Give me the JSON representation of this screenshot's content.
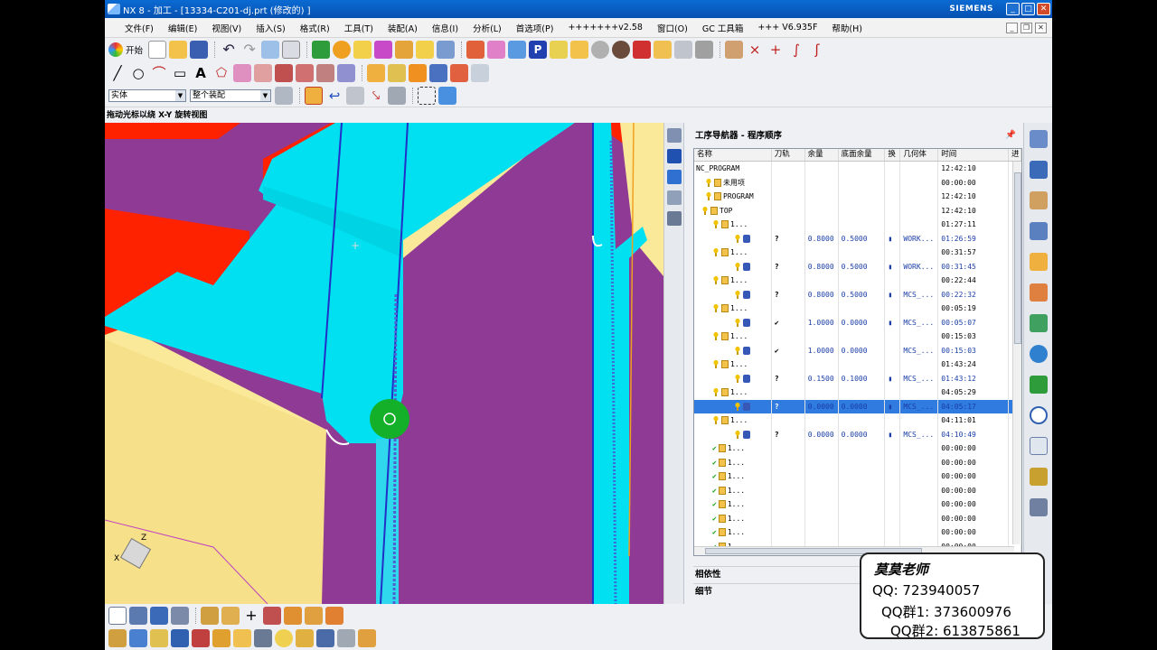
{
  "window": {
    "title": "NX 8 - 加工 - [13334-C201-dj.prt (修改的) ]",
    "brand": "SIEMENS",
    "controls": [
      "_",
      "□",
      "✕"
    ]
  },
  "menu": [
    "文件(F)",
    "编辑(E)",
    "视图(V)",
    "插入(S)",
    "格式(R)",
    "工具(T)",
    "装配(A)",
    "信息(I)",
    "分析(L)",
    "首选项(P)",
    "+++++++v2.58",
    "窗口(O)",
    "GC 工具箱",
    "+++ V6.935F",
    "帮助(H)"
  ],
  "toolbar": {
    "start_label": "开始",
    "filter_select": "实体",
    "assembly_select": "整个装配"
  },
  "cue_line": "拖动光标以绕 X-Y 旋转视图",
  "navigator": {
    "title": "工序导航器 - 程序顺序",
    "columns": [
      "名称",
      "刀轨",
      "余量",
      "底面余量",
      "换",
      "几何体",
      "时间",
      "进"
    ],
    "rows": [
      {
        "name": "NC_PROGRAM",
        "indent": 0,
        "icon": "none",
        "path": "",
        "stock": "",
        "floor": "",
        "chg": "",
        "geo": "",
        "time": "12:42:10",
        "selected": false
      },
      {
        "name": "未用项",
        "indent": 1,
        "icon": "folder",
        "path": "",
        "stock": "",
        "floor": "",
        "chg": "",
        "geo": "",
        "time": "00:00:00",
        "selected": false
      },
      {
        "name": "PROGRAM",
        "indent": 1,
        "icon": "folder",
        "path": "",
        "stock": "",
        "floor": "",
        "chg": "",
        "geo": "",
        "time": "12:42:10",
        "selected": false
      },
      {
        "name": "TOP",
        "indent": 2,
        "icon": "folder",
        "path": "",
        "stock": "",
        "floor": "",
        "chg": "",
        "geo": "",
        "time": "12:42:10",
        "selected": false
      },
      {
        "name": "1...",
        "indent": 3,
        "icon": "folder",
        "path": "",
        "stock": "",
        "floor": "",
        "chg": "",
        "geo": "",
        "time": "01:27:11",
        "selected": false
      },
      {
        "name": "",
        "indent": 4,
        "icon": "op",
        "path": "?",
        "stock": "0.8000",
        "floor": "0.5000",
        "chg": "▮",
        "geo": "WORK...",
        "time": "01:26:59",
        "selected": false
      },
      {
        "name": "1...",
        "indent": 3,
        "icon": "folder",
        "path": "",
        "stock": "",
        "floor": "",
        "chg": "",
        "geo": "",
        "time": "00:31:57",
        "selected": false
      },
      {
        "name": "",
        "indent": 4,
        "icon": "op",
        "path": "?",
        "stock": "0.8000",
        "floor": "0.5000",
        "chg": "▮",
        "geo": "WORK...",
        "time": "00:31:45",
        "selected": false
      },
      {
        "name": "1...",
        "indent": 3,
        "icon": "folder",
        "path": "",
        "stock": "",
        "floor": "",
        "chg": "",
        "geo": "",
        "time": "00:22:44",
        "selected": false
      },
      {
        "name": "",
        "indent": 4,
        "icon": "op",
        "path": "?",
        "stock": "0.8000",
        "floor": "0.5000",
        "chg": "▮",
        "geo": "MCS_...",
        "time": "00:22:32",
        "selected": false
      },
      {
        "name": "1...",
        "indent": 3,
        "icon": "folder",
        "path": "",
        "stock": "",
        "floor": "",
        "chg": "",
        "geo": "",
        "time": "00:05:19",
        "selected": false
      },
      {
        "name": "",
        "indent": 4,
        "icon": "op",
        "path": "✔",
        "stock": "1.0000",
        "floor": "0.0000",
        "chg": "▮",
        "geo": "MCS_...",
        "time": "00:05:07",
        "selected": false
      },
      {
        "name": "1...",
        "indent": 3,
        "icon": "folder",
        "path": "",
        "stock": "",
        "floor": "",
        "chg": "",
        "geo": "",
        "time": "00:15:03",
        "selected": false
      },
      {
        "name": "",
        "indent": 4,
        "icon": "op",
        "path": "✔",
        "stock": "1.0000",
        "floor": "0.0000",
        "chg": "",
        "geo": "MCS_...",
        "time": "00:15:03",
        "selected": false
      },
      {
        "name": "1...",
        "indent": 3,
        "icon": "folder",
        "path": "",
        "stock": "",
        "floor": "",
        "chg": "",
        "geo": "",
        "time": "01:43:24",
        "selected": false
      },
      {
        "name": "",
        "indent": 4,
        "icon": "op",
        "path": "?",
        "stock": "0.1500",
        "floor": "0.1000",
        "chg": "▮",
        "geo": "MCS_...",
        "time": "01:43:12",
        "selected": false
      },
      {
        "name": "1...",
        "indent": 3,
        "icon": "folder",
        "path": "",
        "stock": "",
        "floor": "",
        "chg": "",
        "geo": "",
        "time": "04:05:29",
        "selected": false
      },
      {
        "name": "",
        "indent": 4,
        "icon": "op",
        "path": "?",
        "stock": "0.0000",
        "floor": "0.0000",
        "chg": "▮",
        "geo": "MCS_...",
        "time": "04:05:17",
        "selected": true
      },
      {
        "name": "1...",
        "indent": 3,
        "icon": "folder",
        "path": "",
        "stock": "",
        "floor": "",
        "chg": "",
        "geo": "",
        "time": "04:11:01",
        "selected": false
      },
      {
        "name": "",
        "indent": 4,
        "icon": "op",
        "path": "?",
        "stock": "0.0000",
        "floor": "0.0000",
        "chg": "▮",
        "geo": "MCS_...",
        "time": "04:10:49",
        "selected": false
      },
      {
        "name": "1...",
        "indent": 3,
        "icon": "check",
        "path": "",
        "stock": "",
        "floor": "",
        "chg": "",
        "geo": "",
        "time": "00:00:00",
        "selected": false
      },
      {
        "name": "1...",
        "indent": 3,
        "icon": "check",
        "path": "",
        "stock": "",
        "floor": "",
        "chg": "",
        "geo": "",
        "time": "00:00:00",
        "selected": false
      },
      {
        "name": "1...",
        "indent": 3,
        "icon": "check",
        "path": "",
        "stock": "",
        "floor": "",
        "chg": "",
        "geo": "",
        "time": "00:00:00",
        "selected": false
      },
      {
        "name": "1...",
        "indent": 3,
        "icon": "check",
        "path": "",
        "stock": "",
        "floor": "",
        "chg": "",
        "geo": "",
        "time": "00:00:00",
        "selected": false
      },
      {
        "name": "1...",
        "indent": 3,
        "icon": "check",
        "path": "",
        "stock": "",
        "floor": "",
        "chg": "",
        "geo": "",
        "time": "00:00:00",
        "selected": false
      },
      {
        "name": "1...",
        "indent": 3,
        "icon": "check",
        "path": "",
        "stock": "",
        "floor": "",
        "chg": "",
        "geo": "",
        "time": "00:00:00",
        "selected": false
      },
      {
        "name": "1...",
        "indent": 3,
        "icon": "check",
        "path": "",
        "stock": "",
        "floor": "",
        "chg": "",
        "geo": "",
        "time": "00:00:00",
        "selected": false
      },
      {
        "name": "1...",
        "indent": 3,
        "icon": "check",
        "path": "",
        "stock": "",
        "floor": "",
        "chg": "",
        "geo": "",
        "time": "00:00:00",
        "selected": false
      }
    ],
    "dependencies_label": "相依性",
    "details_label": "细节"
  },
  "overlay": {
    "teacher": "莫莫老师",
    "qq": "QQ: 723940057",
    "group1": "QQ群1: 373600976",
    "group2": "QQ群2: 613875861"
  },
  "colors": {
    "face_red": "#ff2200",
    "face_cyan": "#00e0f0",
    "face_purple": "#8f3a94",
    "face_yellow": "#fbe99a",
    "tool_green": "#15b02a",
    "selection_blue": "#2f7bdf"
  }
}
